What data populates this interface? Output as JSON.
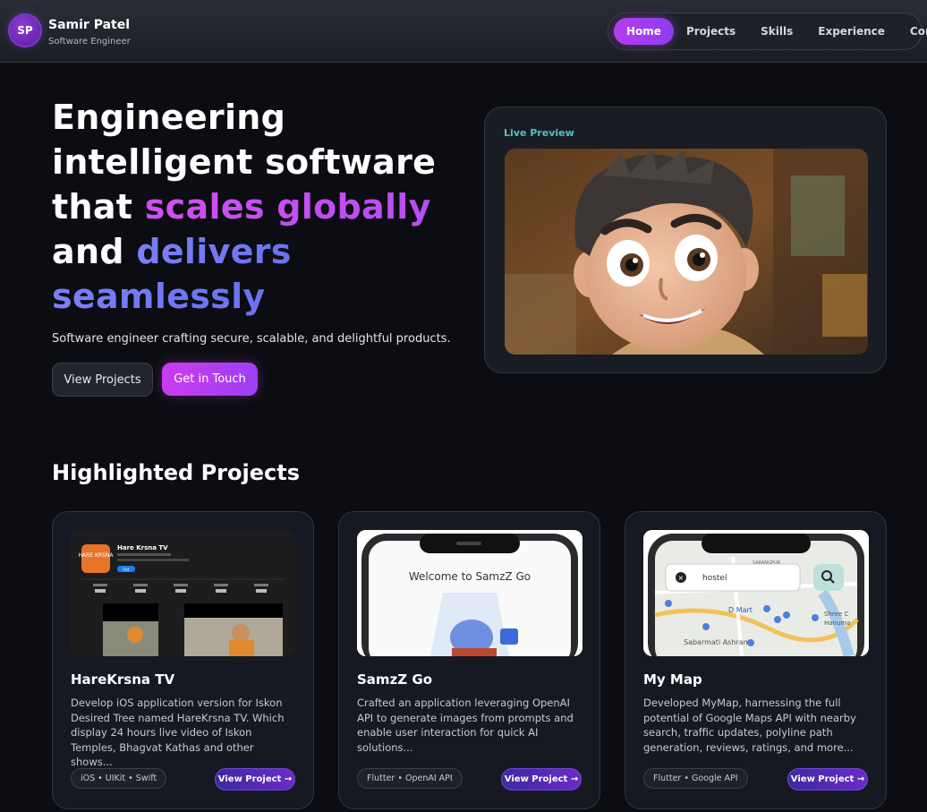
{
  "header": {
    "logo_initials": "SP",
    "name": "Samir Patel",
    "role": "Software Engineer",
    "nav": [
      {
        "label": "Home",
        "active": true
      },
      {
        "label": "Projects",
        "active": false
      },
      {
        "label": "Skills",
        "active": false
      },
      {
        "label": "Experience",
        "active": false
      },
      {
        "label": "Contact",
        "active": false
      }
    ]
  },
  "hero": {
    "title_line1": "Engineering",
    "title_line2": "intelligent software",
    "title_line3a": "that ",
    "title_line3b": "scales globally",
    "title_line4a": "and ",
    "title_line4b": "delivers",
    "title_line5": "seamlessly",
    "subtitle": "Software engineer crafting secure, scalable, and delightful products.",
    "btn_view": "View Projects",
    "btn_touch": "Get in Touch",
    "preview_label": "Live Preview"
  },
  "projects_section": {
    "title": "Highlighted Projects",
    "cards": [
      {
        "title": "HareKrsna TV",
        "desc": "Develop iOS application version for Iskon Desired Tree named HareKrsna TV. Which display 24 hours live video of Iskon Temples, Bhagvat Kathas and other shows...",
        "tag": "iOS • UIKit • Swift",
        "button": "View Project →",
        "thumb": {
          "app_name": "Hare Krsna TV",
          "logo_text": "HARE KRSNA",
          "get_label": "Get"
        }
      },
      {
        "title": "SamzZ Go",
        "desc": "Crafted an application leveraging OpenAI API to generate images from prompts and enable user interaction for quick AI solutions...",
        "tag": "Flutter • OpenAI API",
        "button": "View Project →",
        "thumb": {
          "welcome": "Welcome to SamzZ Go"
        }
      },
      {
        "title": "My Map",
        "desc": "Developed MyMap, harnessing the full potential of Google Maps API with nearby search, traffic updates, polyline path generation, reviews, ratings, and more...",
        "tag": "Flutter • Google API",
        "button": "View Project →",
        "thumb": {
          "search": "hostel",
          "place1": "D Mart",
          "place2": "Sabarmati Ashram",
          "place3": "SARANGPUR",
          "place4": "Shree C",
          "place5": "Hanuma"
        }
      }
    ]
  },
  "colors": {
    "accent_pink": "#c840f0",
    "accent_blue": "#7478f4",
    "preview_label": "#4fc3c0",
    "background": "#0c0d12"
  }
}
